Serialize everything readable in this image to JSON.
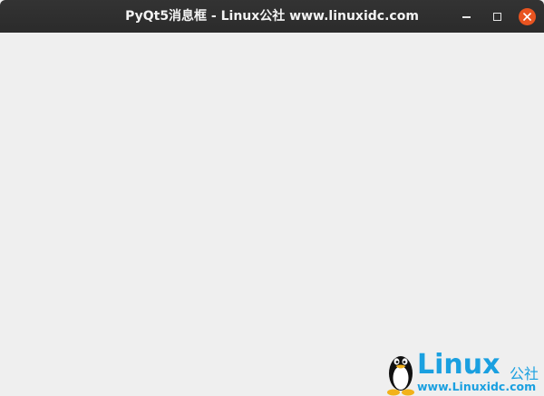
{
  "window": {
    "title": "PyQt5消息框 - Linux公社 www.linuxidc.com",
    "controls": {
      "minimize_icon": "minimize-icon",
      "maximize_icon": "maximize-icon",
      "close_icon": "close-icon"
    }
  },
  "watermark": {
    "logo_text": "Linux",
    "logo_cjk": "公社",
    "url": "www.Linuxidc.com"
  },
  "colors": {
    "titlebar": "#2f2f2f",
    "background": "#efefef",
    "close_button": "#e95420",
    "watermark_blue": "#1aa0e0"
  }
}
